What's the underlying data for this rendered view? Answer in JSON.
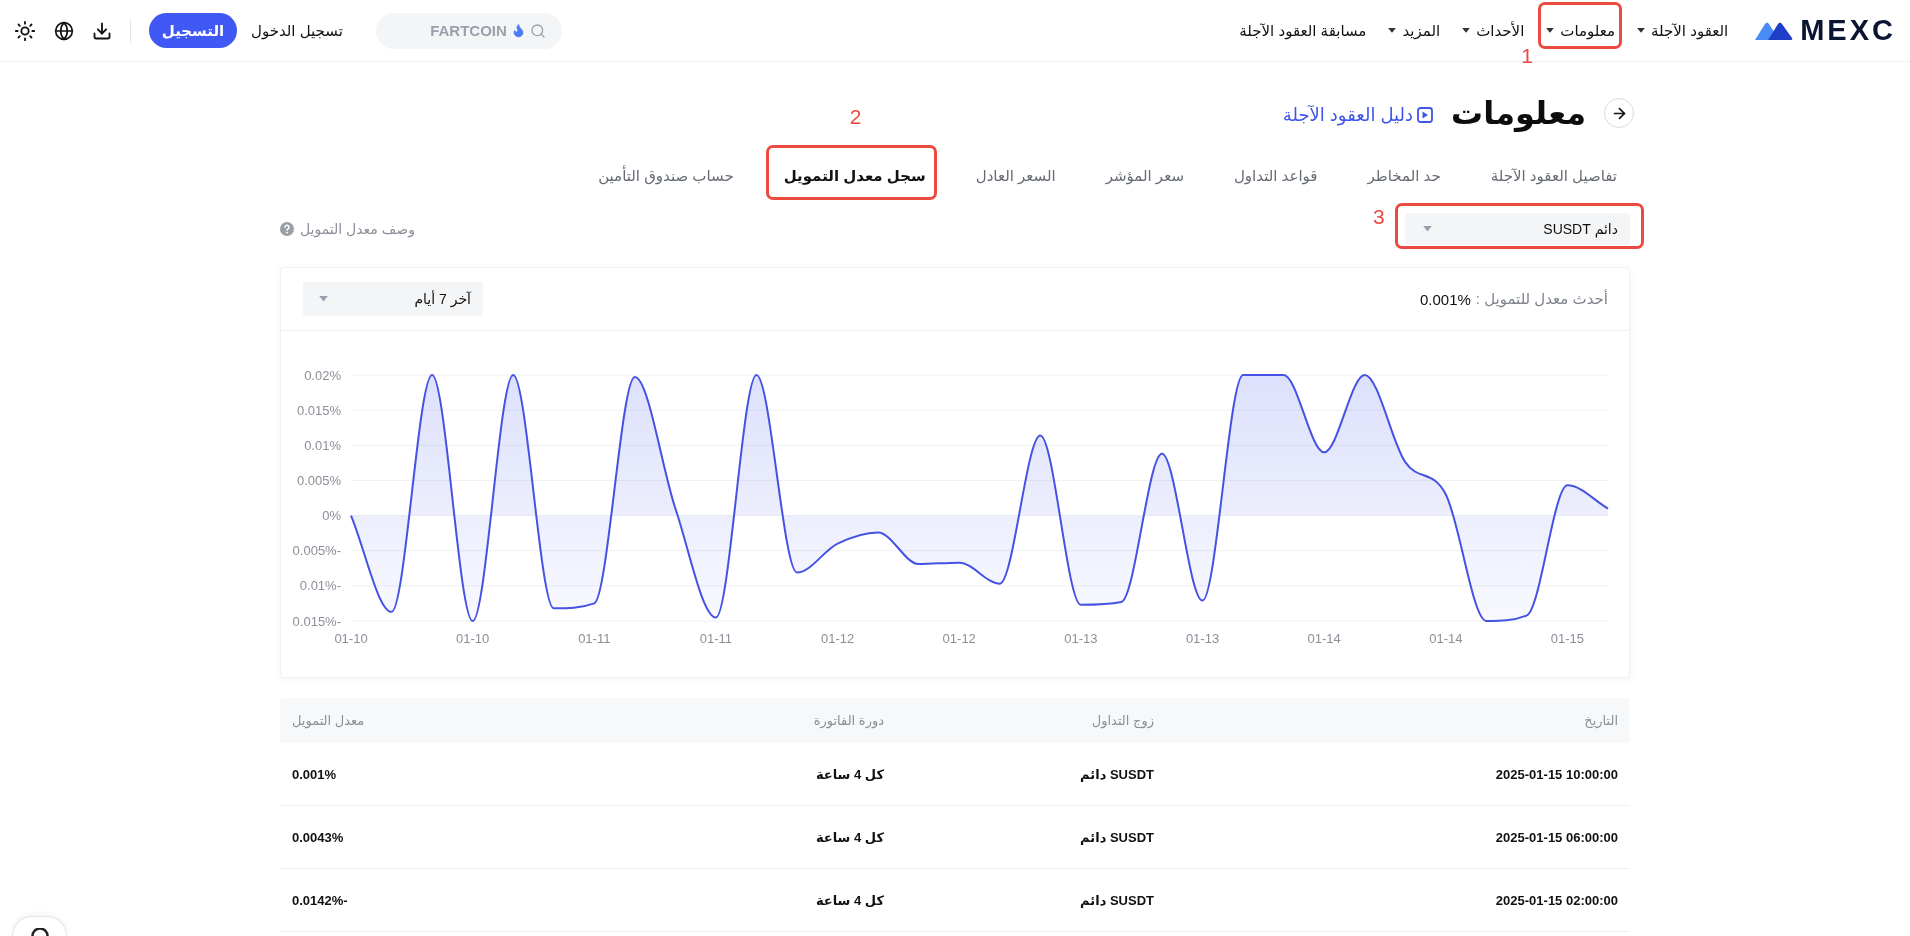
{
  "nav": {
    "logo": "MEXC",
    "items": [
      {
        "label": "العقود الآجلة",
        "dropdown": true
      },
      {
        "label": "معلومات",
        "dropdown": true,
        "callout": "1"
      },
      {
        "label": "الأحداث",
        "dropdown": true
      },
      {
        "label": "المزيد",
        "dropdown": true
      },
      {
        "label": "مسابقة العقود الآجلة",
        "dropdown": false
      }
    ],
    "search": {
      "placeholder": "FARTCOIN"
    },
    "login": "تسجيل الدخول",
    "register": "التسجيل"
  },
  "page_header": {
    "title": "معلومات",
    "guide_link": "دليل العقود الآجلة"
  },
  "tabs": [
    {
      "label": "تفاصيل العقود الآجلة",
      "selected": false
    },
    {
      "label": "حد المخاطر",
      "selected": false
    },
    {
      "label": "قواعد التداول",
      "selected": false
    },
    {
      "label": "سعر المؤشر",
      "selected": false
    },
    {
      "label": "السعر العادل",
      "selected": false
    },
    {
      "label": "سجل معدل التمويل",
      "selected": true,
      "callout": "2"
    },
    {
      "label": "حساب صندوق التأمين",
      "selected": false
    }
  ],
  "contract_select": {
    "value": "دائم SUSDT",
    "callout": "3"
  },
  "rate_description": "وصف معدل التمويل",
  "chart_card": {
    "latest_label": "أحدث معدل للتمويل :",
    "latest_value": "0.001%",
    "period": "آخر 7 أيام",
    "chart_data": {
      "type": "area",
      "grid": true,
      "categories": [
        "01-10",
        null,
        null,
        "01-10",
        null,
        null,
        "01-11",
        null,
        null,
        "01-11",
        null,
        null,
        "01-12",
        null,
        null,
        "01-12",
        null,
        null,
        "01-13",
        null,
        null,
        "01-13",
        null,
        null,
        "01-14",
        null,
        null,
        "01-14",
        null,
        null,
        "01-15",
        null
      ],
      "values": [
        0,
        -0.0137,
        0.02,
        -0.015,
        0.02,
        -0.0132,
        -0.0125,
        0.0197,
        0.001,
        -0.0145,
        0.02,
        -0.0081,
        -0.004,
        -0.0024,
        -0.0069,
        -0.0067,
        -0.0097,
        0.0114,
        -0.0127,
        -0.0123,
        0.0088,
        -0.0121,
        0.02,
        0.02,
        0.009,
        0.02,
        0.0076,
        0.003,
        -0.015,
        -0.0142,
        0.0043,
        0.001
      ],
      "ylim": [
        -0.015,
        0.02
      ],
      "yticks": [
        {
          "value": 0.02,
          "label": "0.02%"
        },
        {
          "value": 0.015,
          "label": "0.015%"
        },
        {
          "value": 0.01,
          "label": "0.01%"
        },
        {
          "value": 0.005,
          "label": "0.005%"
        },
        {
          "value": 0,
          "label": "0%"
        },
        {
          "value": -0.005,
          "label": "0.005%-"
        },
        {
          "value": -0.01,
          "label": "0.01%-"
        },
        {
          "value": -0.015,
          "label": "0.015%-"
        }
      ]
    }
  },
  "table": {
    "columns": [
      "التاريخ",
      "زوج التداول",
      "دورة الفاتورة",
      "معدل التمويل"
    ],
    "rows": [
      [
        "2025-01-15 10:00:00",
        "SUSDT دائم",
        "كل 4 ساعة",
        "0.001%"
      ],
      [
        "2025-01-15 06:00:00",
        "SUSDT دائم",
        "كل 4 ساعة",
        "0.0043%"
      ],
      [
        "2025-01-15 02:00:00",
        "SUSDT دائم",
        "كل 4 ساعة",
        "0.0142%-"
      ]
    ]
  }
}
